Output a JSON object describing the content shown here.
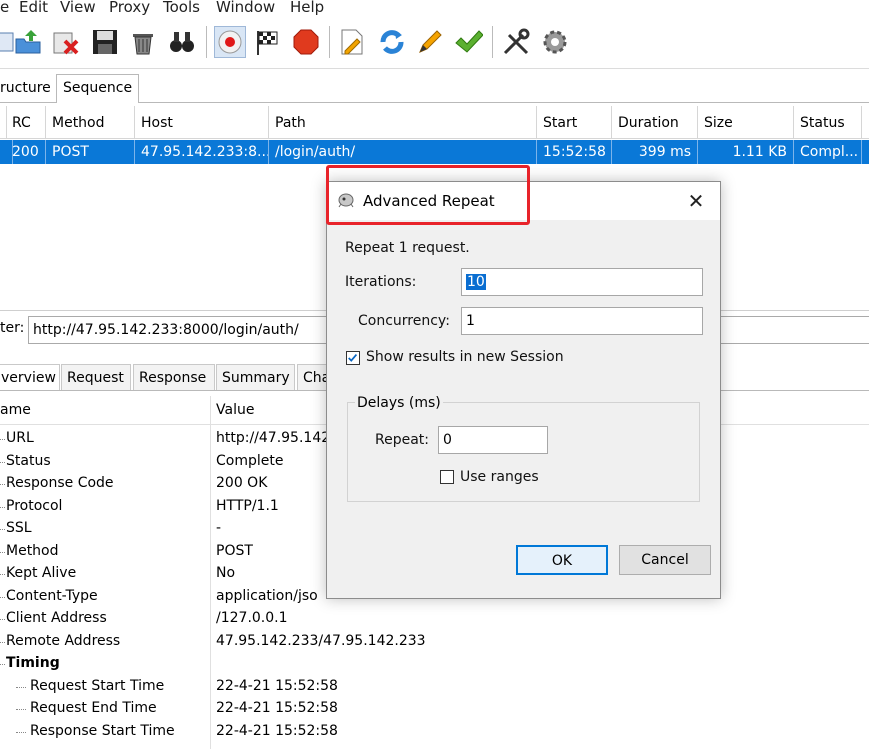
{
  "menu": [
    "e",
    "Edit",
    "View",
    "Proxy",
    "Tools",
    "Window",
    "Help"
  ],
  "toolbar_icons": [
    "new-session-icon",
    "import-icon",
    "clear-icon",
    "save-icon",
    "trash-icon",
    "binoculars-icon",
    "record-icon",
    "flag-icon",
    "stop-icon",
    "edit-icon",
    "repeat-icon",
    "pencil-icon",
    "check-icon",
    "tools-icon",
    "settings-gear-icon"
  ],
  "view_tabs": [
    "ructure",
    "Sequence"
  ],
  "table": {
    "headers": [
      "RC",
      "Method",
      "Host",
      "Path",
      "Start",
      "Duration",
      "Size",
      "Status"
    ],
    "rows": [
      [
        "200",
        "POST",
        "47.95.142.233:8...",
        "/login/auth/",
        "15:52:58",
        "399 ms",
        "1.11 KB",
        "Compl..."
      ]
    ]
  },
  "filter": {
    "label": "ter:",
    "value": "http://47.95.142.233:8000/login/auth/"
  },
  "detail_tabs": [
    "verview",
    "Request",
    "Response",
    "Summary",
    "Cha"
  ],
  "detail": {
    "header_name": "ame",
    "header_value": "Value",
    "rows": [
      {
        "k": "URL",
        "v": "http://47.95.142"
      },
      {
        "k": "Status",
        "v": "Complete"
      },
      {
        "k": "Response Code",
        "v": "200 OK"
      },
      {
        "k": "Protocol",
        "v": "HTTP/1.1"
      },
      {
        "k": "SSL",
        "v": "-"
      },
      {
        "k": "Method",
        "v": "POST"
      },
      {
        "k": "Kept Alive",
        "v": "No"
      },
      {
        "k": "Content-Type",
        "v": "application/jso"
      },
      {
        "k": "Client Address",
        "v": "/127.0.0.1"
      },
      {
        "k": "Remote Address",
        "v": "47.95.142.233/47.95.142.233"
      }
    ],
    "timing_label": "Timing",
    "timing_rows": [
      {
        "k": "Request Start Time",
        "v": "22-4-21 15:52:58"
      },
      {
        "k": "Request End Time",
        "v": "22-4-21 15:52:58"
      },
      {
        "k": "Response Start Time",
        "v": "22-4-21 15:52:58"
      }
    ]
  },
  "dialog": {
    "title": "Advanced Repeat",
    "close": "✕",
    "repeat_text": "Repeat 1 request.",
    "iterations_label": "Iterations:",
    "iterations_value": "10",
    "concurrency_label": "Concurrency:",
    "concurrency_value": "1",
    "show_results_label": "Show results in new Session",
    "show_results_checked": true,
    "delays_group": "Delays (ms)",
    "repeat_label": "Repeat:",
    "repeat_value": "0",
    "use_ranges_label": "Use ranges",
    "use_ranges_checked": false,
    "ok_label": "OK",
    "cancel_label": "Cancel"
  }
}
